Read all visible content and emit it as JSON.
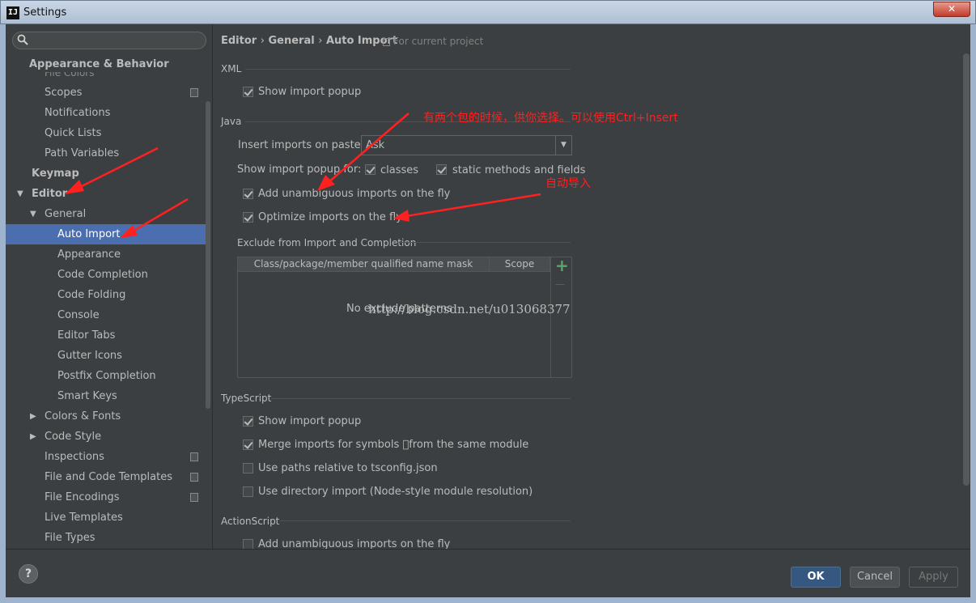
{
  "window": {
    "title": "Settings",
    "app_icon": "IJ",
    "close_glyph": "✕"
  },
  "search": {
    "placeholder": ""
  },
  "sidebar": {
    "cut_item": "File Colors",
    "section_appearance": "Appearance & Behavior",
    "items_appearance": [
      "Scopes",
      "Notifications",
      "Quick Lists",
      "Path Variables"
    ],
    "keymap": "Keymap",
    "editor": "Editor",
    "general": "General",
    "general_children": [
      "Auto Import",
      "Appearance",
      "Code Completion",
      "Code Folding",
      "Console",
      "Editor Tabs",
      "Gutter Icons",
      "Postfix Completion",
      "Smart Keys"
    ],
    "colors_fonts": "Colors & Fonts",
    "code_style": "Code Style",
    "items_bottom": [
      "Inspections",
      "File and Code Templates",
      "File Encodings",
      "Live Templates",
      "File Types"
    ]
  },
  "breadcrumb": {
    "editor": "Editor",
    "sep": "›",
    "general": "General",
    "current": "Auto Import",
    "scope": "For current project"
  },
  "xml": {
    "title": "XML",
    "show_popup": "Show import popup"
  },
  "java": {
    "title": "Java",
    "insert_on_paste_label": "Insert imports on paste:",
    "insert_on_paste_value": "Ask",
    "show_popup_for": "Show import popup for:",
    "classes": "classes",
    "static_methods": "static methods and fields",
    "add_unambiguous": "Add unambiguous imports on the fly",
    "optimize": "Optimize imports on the fly"
  },
  "exclude": {
    "title": "Exclude from Import and Completion",
    "col_mask": "Class/package/member qualified name mask",
    "col_scope": "Scope",
    "empty": "No exclude patterns",
    "add_glyph": "+",
    "remove_glyph": "—"
  },
  "typescript": {
    "title": "TypeScript",
    "show_popup": "Show import popup",
    "merge_imports": "Merge imports for symbols \u0000from the same module",
    "use_paths": "Use paths relative to tsconfig.json",
    "use_directory": "Use directory import (Node-style module resolution)"
  },
  "actionscript": {
    "title": "ActionScript",
    "add_unambiguous": "Add unambiguous imports on the fly"
  },
  "footer": {
    "help": "?",
    "ok": "OK",
    "cancel": "Cancel",
    "apply": "Apply"
  },
  "annotations": {
    "popup_note": "有两个包的时候，供你选择。可以使用Ctrl+Insert",
    "auto_note": "自动导入",
    "watermark": "http://blog.csdn.net/u013068377",
    "color": "#ff2020"
  },
  "colors": {
    "selection": "#4b6eaf",
    "background": "#3c3f41",
    "text": "#bbbbbb",
    "add_green": "#59a869"
  }
}
